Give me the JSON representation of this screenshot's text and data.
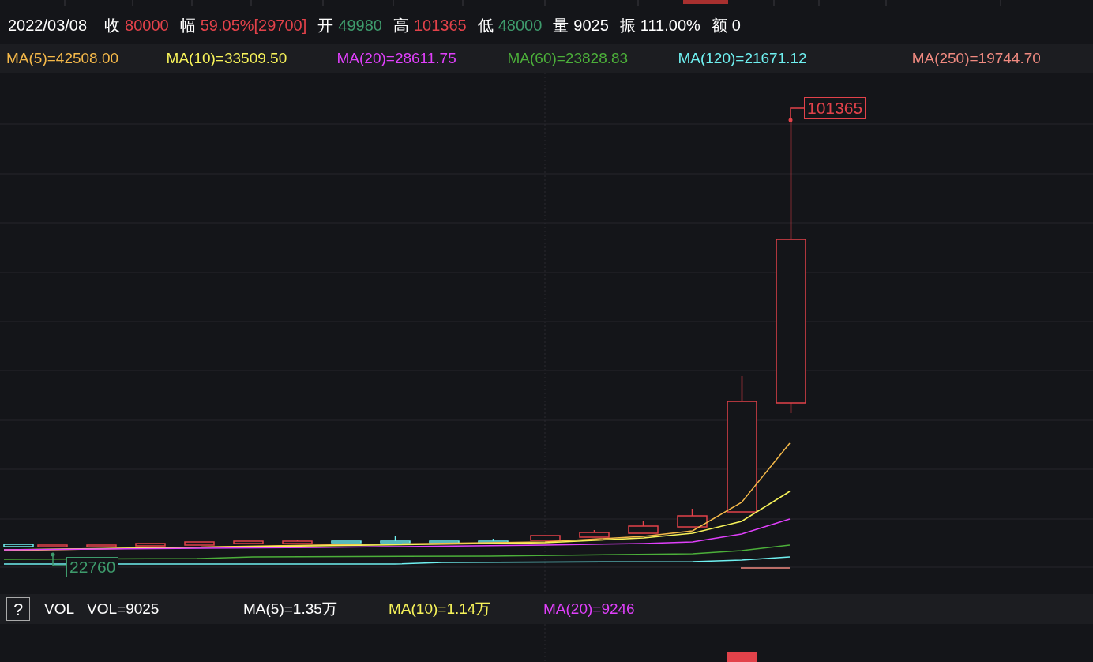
{
  "quote_bar": {
    "date": "2022/03/08",
    "items": [
      {
        "label": "收",
        "value": "80000",
        "color": "#e2424a"
      },
      {
        "label": "幅",
        "value": "59.05%[29700]",
        "color": "#e2424a"
      },
      {
        "label": "开",
        "value": "49980",
        "color": "#3e9b6c"
      },
      {
        "label": "高",
        "value": "101365",
        "color": "#e2424a"
      },
      {
        "label": "低",
        "value": "48000",
        "color": "#3e9b6c"
      },
      {
        "label": "量",
        "value": "9025",
        "color": "#ffffff"
      },
      {
        "label": "振",
        "value": "111.00%",
        "color": "#ffffff"
      },
      {
        "label": "额",
        "value": "0",
        "color": "#ffffff"
      }
    ]
  },
  "ma_legend": [
    {
      "text": "MA(5)=42508.00",
      "color": "#f5b94a"
    },
    {
      "text": "MA(10)=33509.50",
      "color": "#f7f35a"
    },
    {
      "text": "MA(20)=28611.75",
      "color": "#e040fb"
    },
    {
      "text": "MA(60)=23828.83",
      "color": "#4caf3a"
    },
    {
      "text": "MA(120)=21671.12",
      "color": "#6ff0f0"
    },
    {
      "text": "MA(250)=19744.70",
      "color": "#f08a80"
    }
  ],
  "chart": {
    "high_label": "101365",
    "low_label": "22760"
  },
  "volume_legend": {
    "help": "?",
    "title": "VOL",
    "items": [
      {
        "text": "VOL=9025",
        "color": "#ffffff"
      },
      {
        "text": "MA(5)=1.35万",
        "color": "#ffffff"
      },
      {
        "text": "MA(10)=1.14万",
        "color": "#f7f35a"
      },
      {
        "text": "MA(20)=9246",
        "color": "#e040fb"
      }
    ]
  }
}
